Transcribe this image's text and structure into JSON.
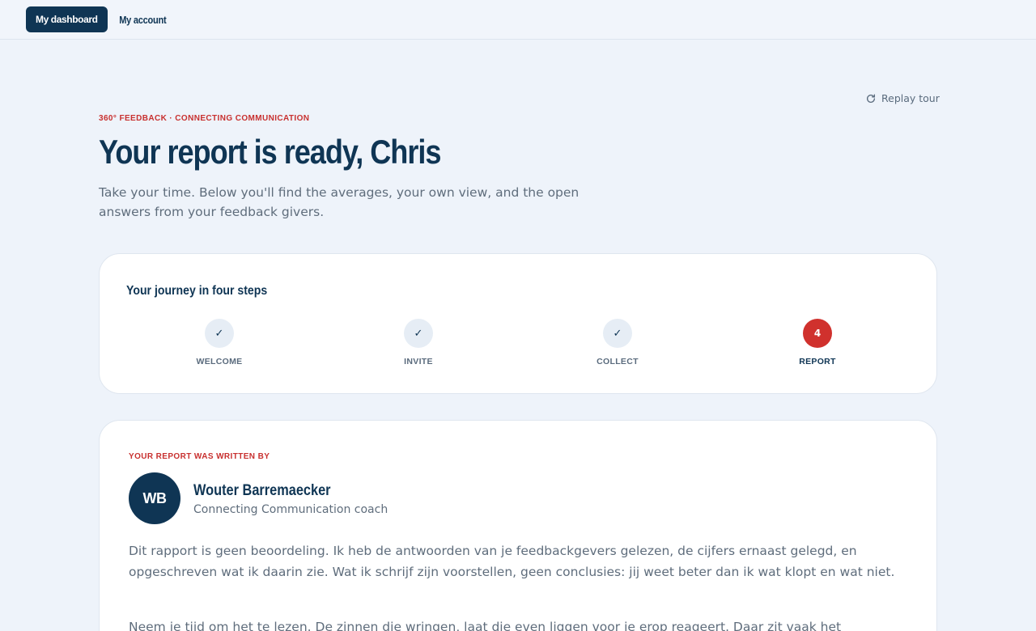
{
  "nav": {
    "dashboard": "My dashboard",
    "account": "My account"
  },
  "replay_tour": "Replay tour",
  "eyebrow": "360° FEEDBACK · CONNECTING COMMUNICATION",
  "title": "Your report is ready, Chris",
  "lead": "Take your time. Below you'll find the averages, your own view, and the open answers from your feedback givers.",
  "journey": {
    "title": "Your journey in four steps",
    "steps": [
      {
        "label": "WELCOME",
        "marker": "✓",
        "state": "done"
      },
      {
        "label": "INVITE",
        "marker": "✓",
        "state": "done"
      },
      {
        "label": "COLLECT",
        "marker": "✓",
        "state": "done"
      },
      {
        "label": "REPORT",
        "marker": "4",
        "state": "current"
      }
    ]
  },
  "author": {
    "eyebrow": "YOUR REPORT WAS WRITTEN BY",
    "initials": "WB",
    "name": "Wouter Barremaecker",
    "role": "Connecting Communication coach",
    "paragraph_1": "Dit rapport is geen beoordeling. Ik heb de antwoorden van je feedbackgevers gelezen, de cijfers ernaast gelegd, en opgeschreven wat ik daarin zie. Wat ik schrijf zijn voorstellen, geen conclusies: jij weet beter dan ik wat klopt en wat niet.",
    "paragraph_2": "Neem je tijd om het te lezen. De zinnen die wringen, laat die even liggen voor je erop reageert. Daar zit vaak het"
  },
  "colors": {
    "navy": "#0f3554",
    "accent_red": "#d0312d",
    "background": "#eef3fa"
  }
}
